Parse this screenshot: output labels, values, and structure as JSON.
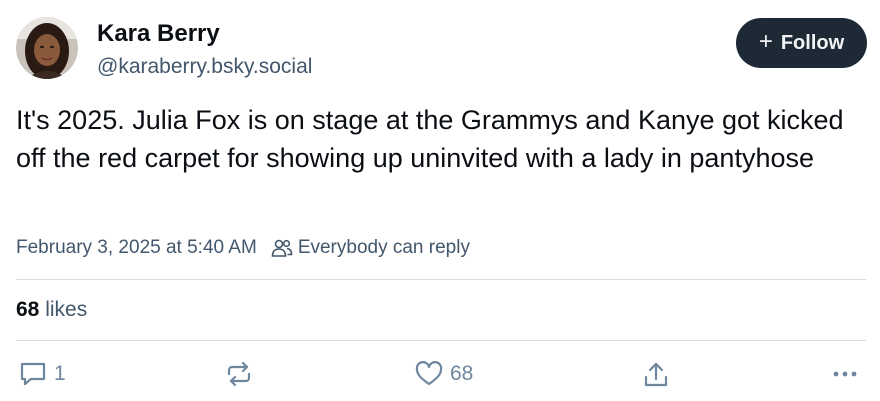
{
  "author": {
    "display_name": "Kara Berry",
    "handle": "@karaberry.bsky.social",
    "avatar_icon": "user-avatar-photo"
  },
  "follow_button": {
    "icon": "plus",
    "label": "Follow",
    "bg_color": "#1e2936"
  },
  "post": {
    "text": "It's 2025. Julia Fox is on stage at the Grammys and Kanye got kicked off the red carpet for showing up uninvited with a lady in pantyhose",
    "timestamp": "February 3, 2025 at 5:40 AM",
    "reply_setting": "Everybody can reply"
  },
  "stats": {
    "likes_count": "68",
    "likes_label": "likes"
  },
  "actions": {
    "reply_count": "1",
    "repost_count": "",
    "like_count": "68",
    "icons": [
      "reply-icon",
      "repost-icon",
      "like-icon",
      "share-icon",
      "more-icon"
    ]
  },
  "colors": {
    "text": "#0b0f14",
    "muted": "#42576c",
    "icon": "#6f869f",
    "divider": "#d4dbe2"
  }
}
